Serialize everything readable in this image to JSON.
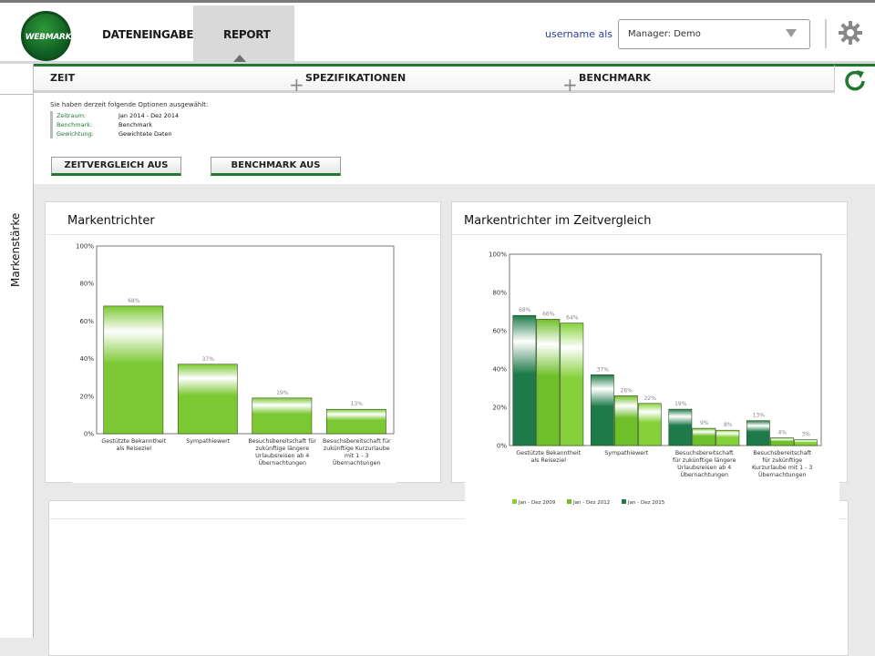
{
  "header": {
    "logo_text": "WEBMARK",
    "nav": [
      {
        "label": "DATENEINGABE"
      },
      {
        "label": "REPORT"
      }
    ],
    "username": "username als",
    "manager_select": "Manager: Demo"
  },
  "sidebar": {
    "label": "Markenstärke"
  },
  "filters": {
    "tabs": [
      {
        "label": "ZEIT"
      },
      {
        "label": "SPEZIFIKATIONEN"
      },
      {
        "label": "BENCHMARK"
      }
    ]
  },
  "options": {
    "title": "Sie haben derzeit folgende Optionen ausgewählt:",
    "rows": [
      {
        "key": "Zeitraum:",
        "value": "Jan 2014 - Dez 2014"
      },
      {
        "key": "Benchmark:",
        "value": "Benchmark"
      },
      {
        "key": "Gewichtung:",
        "value": "Gewichtete Daten"
      }
    ],
    "buttons": [
      "ZEITVERGLEICH AUS",
      "BENCHMARK AUS"
    ]
  },
  "cards": [
    {
      "title": "Markentrichter"
    },
    {
      "title": "Markentrichter im Zeitvergleich"
    }
  ],
  "colors": {
    "accent": "#1f7a30",
    "light_green": "#7bc832",
    "mid_green": "#6fbf2a",
    "dark_green": "#1e7a4a"
  },
  "chart_data": [
    {
      "type": "bar",
      "categories": [
        "Gestützte Bekanntheit als Reiseziel",
        "Sympathiewert",
        "Besuchsbereitschaft für zukünftige längere Urlaubsreisen ab 4 Übernachtungen",
        "Besuchsbereitschaft für zukünftige Kurzurlaube mit 1 - 3 Übernachtungen"
      ],
      "category_lines": [
        [
          "Gestützte Bekanntheit",
          "als Reiseziel"
        ],
        [
          "Sympathiewert"
        ],
        [
          "Besuchsbereitschaft für",
          "zukünftige längere",
          "Urlaubsreisen ab 4",
          "Übernachtungen"
        ],
        [
          "Besuchsbereitschaft für",
          "zukünftige Kurzurlaube",
          "mit 1 - 3",
          "Übernachtungen"
        ]
      ],
      "values": [
        68,
        37,
        19,
        13
      ],
      "value_labels": [
        "68%",
        "37%",
        "19%",
        "13%"
      ],
      "ylim": [
        0,
        100
      ],
      "yticks": [
        "0%",
        "20%",
        "40%",
        "60%",
        "80%",
        "100%"
      ],
      "grid": false
    },
    {
      "type": "bar",
      "categories": [
        "Gestützte Bekanntheit als Reiseziel",
        "Sympathiewert",
        "Besuchsbereitschaft für zukünftige längere Urlaubsreisen ab 4 Übernachtungen",
        "Besuchsbereitschaft für zukünftige Kurzurlaube mit 1 - 3 Übernachtungen"
      ],
      "category_lines": [
        [
          "Gestützte Bekanntheit",
          "als Reiseziel"
        ],
        [
          "Sympathiewert"
        ],
        [
          "Besuchsbereitschaft",
          "für zukünftige längere",
          "Urlaubsreisen ab 4",
          "Übernachtungen"
        ],
        [
          "Besuchsbereitschaft",
          "für zukünftige",
          "Kurzurlaube mit 1 - 3",
          "Übernachtungen"
        ]
      ],
      "series": [
        {
          "name": "Jan - Dez 2015",
          "values": [
            68,
            37,
            19,
            13
          ],
          "labels": [
            "68%",
            "37%",
            "19%",
            "13%"
          ],
          "color": "#1e7a4a"
        },
        {
          "name": "Jan - Dez 2012",
          "values": [
            66,
            26,
            9,
            4
          ],
          "labels": [
            "66%",
            "26%",
            "9%",
            "4%"
          ],
          "color": "#6fbf2a"
        },
        {
          "name": "Jan - Dez 2009",
          "values": [
            64,
            22,
            8,
            3
          ],
          "labels": [
            "64%",
            "22%",
            "8%",
            "3%"
          ],
          "color": "#86d13a"
        }
      ],
      "legend": [
        "Jan - Dez 2009",
        "Jan - Dez 2012",
        "Jan - Dez 2015"
      ],
      "legend_position": "bottom",
      "ylim": [
        0,
        100
      ],
      "yticks": [
        "0%",
        "20%",
        "40%",
        "60%",
        "80%",
        "100%"
      ],
      "grid": false
    }
  ]
}
